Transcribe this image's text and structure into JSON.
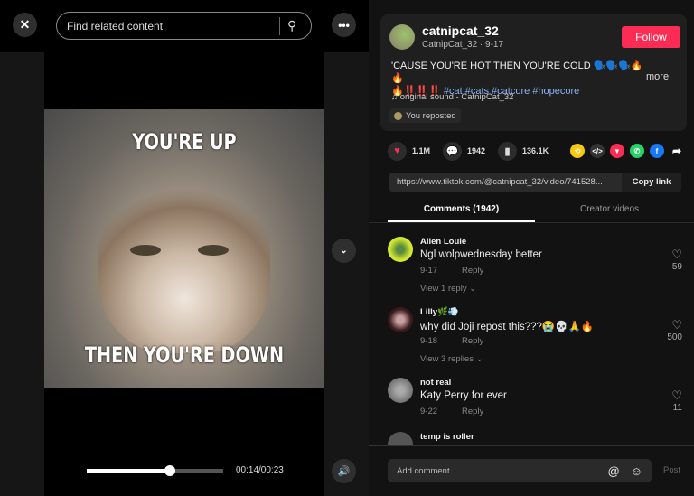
{
  "player": {
    "search_placeholder": "Find related content",
    "caption_top": "YOU'RE UP",
    "caption_bottom": "THEN YOU'RE DOWN",
    "time": "00:14/00:23",
    "progress_fraction": 0.61
  },
  "post": {
    "username": "catnipcat_32",
    "subtitle": "CatnipCat_32 · 9-17",
    "follow_label": "Follow",
    "description": "'CAUSE YOU'RE HOT THEN YOU'RE COLD 🗣️🗣️🗣️🔥🔥",
    "description_line2_emoji": "🔥",
    "description_exclaim": "‼️‼️‼️",
    "hashtags": "#cat #cats #catcore #hopecore",
    "more_label": "more",
    "sound": "original sound - CatnipCat_32",
    "repost_label": "You reposted"
  },
  "stats": {
    "likes": "1.1M",
    "comments": "1942",
    "saves": "136.1K"
  },
  "share": {
    "url": "https://www.tiktok.com/@catnipcat_32/video/741528...",
    "copy_label": "Copy link"
  },
  "tabs": {
    "comments": "Comments (1942)",
    "creator": "Creator videos"
  },
  "comments": [
    {
      "name": "Alien Louie",
      "text": "Ngl wolpwednesday better",
      "date": "9-17",
      "reply": "Reply",
      "likes": "59",
      "view_replies": "View 1 reply ⌄"
    },
    {
      "name": "Lilly🌿💨",
      "text": "why did Joji repost this???😭💀🙏🔥",
      "date": "9-18",
      "reply": "Reply",
      "likes": "500",
      "view_replies": "View 3 replies ⌄"
    },
    {
      "name": "not real",
      "text": "Katy Perry for ever",
      "date": "9-22",
      "reply": "Reply",
      "likes": "11"
    },
    {
      "name": "temp is roller"
    }
  ],
  "composer": {
    "placeholder": "Add comment...",
    "post_label": "Post"
  },
  "colors": {
    "accent": "#fe2c55",
    "hashtag": "#8ab4f8"
  }
}
